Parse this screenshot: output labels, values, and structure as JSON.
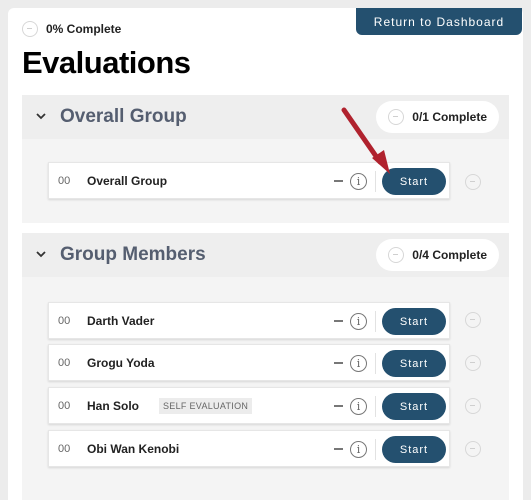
{
  "header": {
    "dashboard_button": "Return to Dashboard",
    "progress_text": "0% Complete",
    "title": "Evaluations"
  },
  "sections": [
    {
      "title": "Overall Group",
      "progress": "0/1 Complete",
      "rows": [
        {
          "number": "00",
          "name": "Overall Group",
          "tag": "",
          "dash": "–",
          "info": "i",
          "button": "Start"
        }
      ]
    },
    {
      "title": "Group Members",
      "progress": "0/4 Complete",
      "rows": [
        {
          "number": "00",
          "name": "Darth Vader",
          "tag": "",
          "dash": "–",
          "info": "i",
          "button": "Start"
        },
        {
          "number": "00",
          "name": "Grogu Yoda",
          "tag": "",
          "dash": "–",
          "info": "i",
          "button": "Start"
        },
        {
          "number": "00",
          "name": "Han Solo",
          "tag": "SELF EVALUATION",
          "dash": "–",
          "info": "i",
          "button": "Start"
        },
        {
          "number": "00",
          "name": "Obi Wan Kenobi",
          "tag": "",
          "dash": "–",
          "info": "i",
          "button": "Start"
        }
      ]
    }
  ],
  "colors": {
    "primary": "#24506f",
    "annotation_arrow": "#b0222e"
  },
  "icons": [
    "progress-circle-icon",
    "chevron-down-icon",
    "info-icon",
    "annotation-arrow-icon"
  ]
}
